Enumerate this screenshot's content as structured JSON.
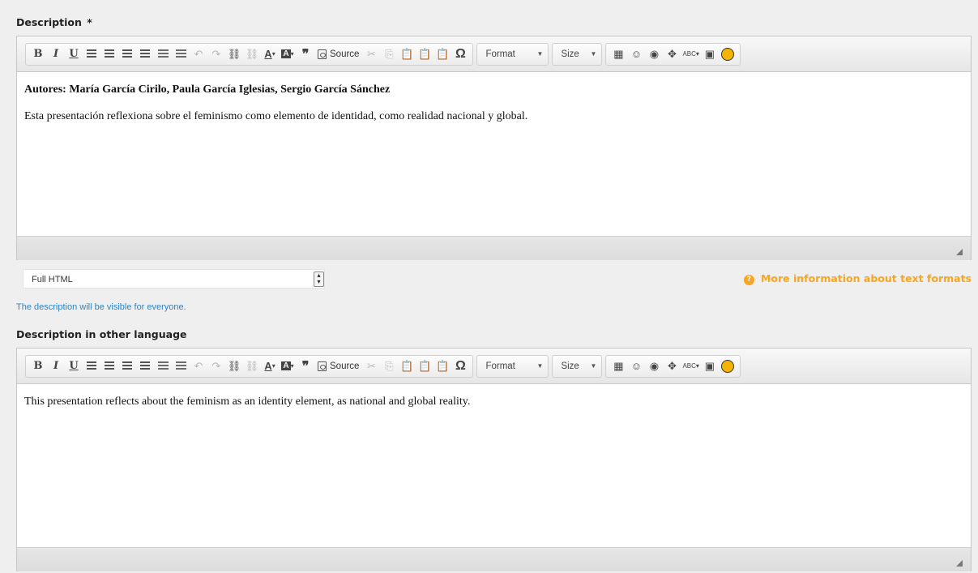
{
  "description": {
    "label": "Description",
    "required_marker": "*",
    "content": {
      "authors": "Autores: María García Cirilo, Paula García Iglesias, Sergio García Sánchez",
      "text": "Esta presentación reflexiona sobre el feminismo como elemento de identidad, como realidad nacional y global."
    }
  },
  "toolbar": {
    "bold": "B",
    "italic": "I",
    "underline": "U",
    "text_color": "A",
    "bg_color": "A",
    "blockquote": "”",
    "source": "Source",
    "special_char": "Ω",
    "format": "Format",
    "size": "Size",
    "spell": "ABC"
  },
  "text_format": {
    "selected": "Full HTML",
    "more_info": "More information about text formats",
    "help": "The description will be visible for everyone."
  },
  "other_language": {
    "label": "Description in other language",
    "content": {
      "text": "This presentation reflects about the feminism as an identity element, as national and global reality."
    }
  },
  "colors": {
    "accent_orange": "#f7a623",
    "help_blue": "#2b84c6"
  }
}
